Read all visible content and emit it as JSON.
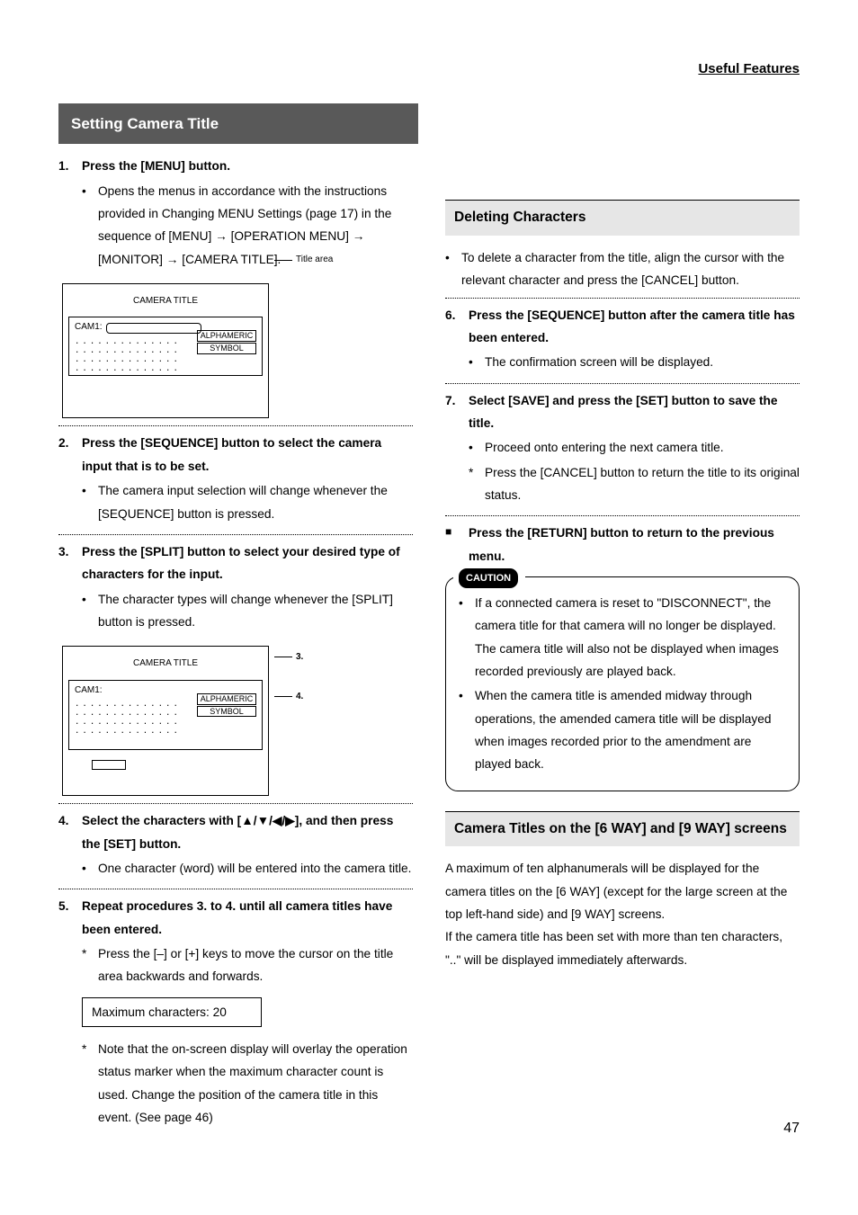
{
  "header": {
    "title": "Useful Features"
  },
  "section": {
    "title": "Setting Camera Title"
  },
  "diagram": {
    "title": "CAMERA TITLE",
    "cam_label": "CAM1:",
    "btn_alpha": "ALPHAMERIC",
    "btn_symbol": "SYMBOL",
    "side_title_area": "Title area",
    "annot_3": "3.",
    "annot_4": "4."
  },
  "left": {
    "s1_head": "Press the [MENU] button.",
    "s1_b1": "Opens the menus in accordance with the instructions provided in Changing MENU Settings (page 17) in the sequence of [MENU] → [OPERATION MENU] → [MONITOR] → [CAMERA TITLE].",
    "s2_head": "Press the [SEQUENCE] button to select the camera input that is to be set.",
    "s2_b1": "The camera input selection will change whenever the [SEQUENCE] button is pressed.",
    "s3_head": "Press the [SPLIT] button to select your desired type of characters for the input.",
    "s3_b1": "The character types will change whenever the [SPLIT] button is pressed.",
    "s4_head": "Select the characters with [▲/▼/◀/▶], and then press the [SET] button.",
    "s4_b1": "One character (word) will be entered into the camera title.",
    "s5_head": "Repeat procedures 3. to 4. until all camera titles have been entered.",
    "s5_star": "Press the [–] or [+] keys to move the cursor on the title area backwards and forwards.",
    "maxchars": "Maximum characters: 20",
    "s5_star2": "Note that the on-screen display will overlay the operation status marker when the maximum character count is used. Change the position of the camera title in this event. (See page 46)"
  },
  "right": {
    "del_title": "Deleting Characters",
    "del_b1": "To delete a character from the title, align the cursor with the relevant character and press the [CANCEL] button.",
    "s6_head": "Press the [SEQUENCE] button after the camera title has been entered.",
    "s6_b1": "The confirmation screen will be displayed.",
    "s7_head": "Select [SAVE] and press the [SET] button to save the title.",
    "s7_b1": "Proceed onto entering the next camera title.",
    "s7_star": "Press the [CANCEL] button to return the title to its original status.",
    "return_note": "Press the [RETURN] button to return to the previous menu.",
    "caution_label": "CAUTION",
    "caution_b1": "If a connected camera is reset to \"DISCONNECT\", the camera title for that camera will no longer be displayed. The camera title will also not be displayed when images recorded previously are played back.",
    "caution_b2": "When the camera title is amended midway through operations, the amended camera title will be displayed when images recorded prior to the amendment are played back.",
    "way_title": "Camera Titles on the [6 WAY] and [9 WAY] screens",
    "way_p1": "A maximum of ten alphanumerals will be displayed for the camera titles on the [6 WAY] (except for the large screen at the top left-hand side) and [9 WAY] screens.",
    "way_p2": "If the camera title has been set with more than ten characters, \"..\" will be displayed immediately afterwards."
  },
  "pagenum": "47",
  "nums": {
    "n1": "1.",
    "n2": "2.",
    "n3": "3.",
    "n4": "4.",
    "n5": "5.",
    "n6": "6.",
    "n7": "7."
  }
}
